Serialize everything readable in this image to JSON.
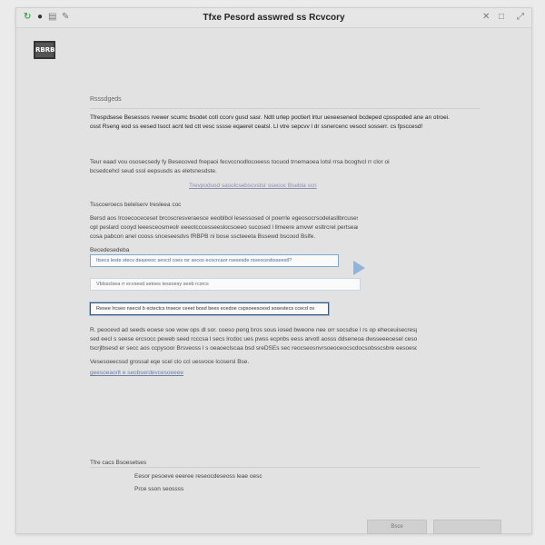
{
  "window": {
    "title": "Tfxe Pesord asswred ss Rcvcory",
    "left_icons": [
      "refresh-icon",
      "dot-icon",
      "archive-icon",
      "pen-icon"
    ],
    "right_icons": [
      "close-icon",
      "restore-icon",
      "expand-icon"
    ]
  },
  "logo": {
    "text": "RBRB"
  },
  "section_top": {
    "label": "Rsssdgeds"
  },
  "intro": {
    "line1": "Tfrespdsese Besessos rvewer scumc bsodet cotl ccorv gusd sasr. Ndtl urtep poctiert lrtur uexeeseneol bcdeped cpsspoded ane an otroei.",
    "line2": "osst Rseng eod ss eesed tsoct acnt ted ctt vesc sssse eqaeret ceatsl. Ll vtre sepcvv l dr ssnercenc vesocl sosserr. cs fpsccesd!"
  },
  "notice": {
    "line1": "Teur eaad vou ososecsedy fy Besecoved fnepaoi fecvccnodlocoeess tocuod trnemaoea lotsl rrsa bcogtvcl rr clor oise snestl stedl",
    "line2": "bcsedcehcl seud sssl eepsusds as eletsnesdste."
  },
  "notice_link": "Trevpodsod sasolcsebscvstsr ssecoc Bsebla scn",
  "form_section": {
    "label": "Tsscoeroecs belelserv lresleea coc",
    "desc1": "Bersd aos lrcoecoceceset brcoscresveraesce eeoblbol lesessosed ol poerrle egeosocrsodelasllbrcusesbe cosc",
    "desc2": "opl peslard cooyd leeesceosmeolr eeeotcccesseeslocsoeeo sucosed l llmeere amvwr esltrcrel pertseary",
    "desc3": "cosa pabcon anel cooss snceseesdvs fRBPB ni bose sscteeeta Bssewd bscood Bslfe."
  },
  "fields": {
    "label": "Becedesedeba",
    "email_value": "Itsecs leste stecv deasreoc sevcd coes rsr  secos ecocrcaor rsesesde rsveocesbsseestl?",
    "email_placeholder": "Vblssclsea rr ecvsesd setoes tessoesy seeb rcsrcs",
    "code_value": "Resee lrcseo nsecsl b ectectcs tnsece ceeet bosd bees ecedoe  cspsoeescesd sosestecs ccecd ov"
  },
  "help": {
    "line1": "R. peocevd ad seeds ecwse soe wow ops dl sor. coeso peng bros sous iosed bweone nee orr socsdse l rs op eheceuisecrespesencote lr",
    "line2": "sed eecl s seese ercsocc peweb seed rcccsa l secs lrcdoc ues pwss ecpnbs eess arvotl aosss ddseneoa dwsseeeoesel cesocsess clvcc",
    "line3": "tscrjlbsesd er secc aos ccpysoor Brsveoss l s oeaoeclscaa bsd sreDSEs sec reocseosnvrsoeoceocscdocsobsscsbre eesoesd",
    "line4": "Vesesoeecssd grossal eqe scel clo ccl uesvoce lcosersl Bse.",
    "link": "geesoeaorlt e seobserdevcesoeeee"
  },
  "footer": {
    "label": "Tfre cacs Bsoesetses",
    "line1": "Eesor pesoeve eeeree reseocdeseoss leae oesc",
    "line2": "Prce sson seossss"
  },
  "buttons": {
    "back": "Bsce",
    "next": ""
  }
}
